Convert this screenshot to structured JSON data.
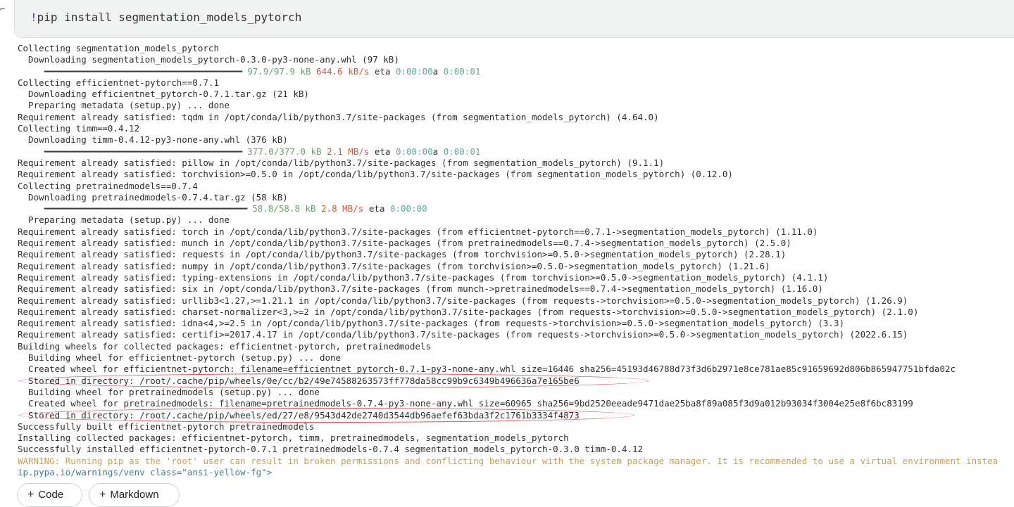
{
  "code": {
    "bang": "!",
    "command": "pip install segmentation_models_pytorch"
  },
  "output_lines": [
    {
      "text": "Collecting segmentation_models_pytorch"
    },
    {
      "text": "  Downloading segmentation_models_pytorch-0.3.0-py3-none-any.whl (97 kB)"
    },
    {
      "progress": {
        "indent": "     ",
        "bar": "━━━━━━━━━━━━━━━━━━━━━━━━━━━━━━━━━━━━━━━━",
        "size": "97.9/97.9 kB",
        "speed": "644.6 kB/s",
        "eta_label": "eta",
        "eta": "0:00:00",
        "extra": "a",
        "eta2": "0:00:01"
      }
    },
    {
      "text": "Collecting efficientnet-pytorch==0.7.1"
    },
    {
      "text": "  Downloading efficientnet_pytorch-0.7.1.tar.gz (21 kB)"
    },
    {
      "text": "  Preparing metadata (setup.py) ... done"
    },
    {
      "text": "Requirement already satisfied: tqdm in /opt/conda/lib/python3.7/site-packages (from segmentation_models_pytorch) (4.64.0)"
    },
    {
      "text": "Collecting timm==0.4.12"
    },
    {
      "text": "  Downloading timm-0.4.12-py3-none-any.whl (376 kB)"
    },
    {
      "progress": {
        "indent": "     ",
        "bar": "━━━━━━━━━━━━━━━━━━━━━━━━━━━━━━━━━━━━━━━━",
        "size": "377.0/377.0 kB",
        "speed": "2.1 MB/s",
        "eta_label": "eta",
        "eta": "0:00:00",
        "extra": "a",
        "eta2": "0:00:01"
      }
    },
    {
      "text": "Requirement already satisfied: pillow in /opt/conda/lib/python3.7/site-packages (from segmentation_models_pytorch) (9.1.1)"
    },
    {
      "text": "Requirement already satisfied: torchvision>=0.5.0 in /opt/conda/lib/python3.7/site-packages (from segmentation_models_pytorch) (0.12.0)"
    },
    {
      "text": "Collecting pretrainedmodels==0.7.4"
    },
    {
      "text": "  Downloading pretrainedmodels-0.7.4.tar.gz (58 kB)"
    },
    {
      "progress": {
        "indent": "     ",
        "bar": "━━━━━━━━━━━━━━━━━━━━━━━━━━━━━━━━━━━━━━━━━",
        "size": "58.8/58.8 kB",
        "speed": "2.8 MB/s",
        "eta_label": "eta",
        "eta": "0:00:00",
        "extra": "",
        "eta2": ""
      }
    },
    {
      "text": "  Preparing metadata (setup.py) ... done"
    },
    {
      "text": "Requirement already satisfied: torch in /opt/conda/lib/python3.7/site-packages (from efficientnet-pytorch==0.7.1->segmentation_models_pytorch) (1.11.0)"
    },
    {
      "text": "Requirement already satisfied: munch in /opt/conda/lib/python3.7/site-packages (from pretrainedmodels==0.7.4->segmentation_models_pytorch) (2.5.0)"
    },
    {
      "text": "Requirement already satisfied: requests in /opt/conda/lib/python3.7/site-packages (from torchvision>=0.5.0->segmentation_models_pytorch) (2.28.1)"
    },
    {
      "text": "Requirement already satisfied: numpy in /opt/conda/lib/python3.7/site-packages (from torchvision>=0.5.0->segmentation_models_pytorch) (1.21.6)"
    },
    {
      "text": "Requirement already satisfied: typing-extensions in /opt/conda/lib/python3.7/site-packages (from torchvision>=0.5.0->segmentation_models_pytorch) (4.1.1)"
    },
    {
      "text": "Requirement already satisfied: six in /opt/conda/lib/python3.7/site-packages (from munch->pretrainedmodels==0.7.4->segmentation_models_pytorch) (1.16.0)"
    },
    {
      "text": "Requirement already satisfied: urllib3<1.27,>=1.21.1 in /opt/conda/lib/python3.7/site-packages (from requests->torchvision>=0.5.0->segmentation_models_pytorch) (1.26.9)"
    },
    {
      "text": "Requirement already satisfied: charset-normalizer<3,>=2 in /opt/conda/lib/python3.7/site-packages (from requests->torchvision>=0.5.0->segmentation_models_pytorch) (2.1.0)"
    },
    {
      "text": "Requirement already satisfied: idna<4,>=2.5 in /opt/conda/lib/python3.7/site-packages (from requests->torchvision>=0.5.0->segmentation_models_pytorch) (3.3)"
    },
    {
      "text": "Requirement already satisfied: certifi>=2017.4.17 in /opt/conda/lib/python3.7/site-packages (from requests->torchvision>=0.5.0->segmentation_models_pytorch) (2022.6.15)"
    },
    {
      "text": "Building wheels for collected packages: efficientnet-pytorch, pretrainedmodels"
    },
    {
      "text": "  Building wheel for efficientnet-pytorch (setup.py) ... done"
    },
    {
      "text": "  Created wheel for efficientnet-pytorch: filename=efficientnet_pytorch-0.7.1-py3-none-any.whl size=16446 sha256=45193d46788d73f3d6b2971e8ce781ae85c91659692d806b865947751bfda02c"
    },
    {
      "text": "  Stored in directory: /root/.cache/pip/wheels/0e/cc/b2/49e74588263573ff778da58cc99b9c6349b496636a7e165be6"
    },
    {
      "text": "  Building wheel for pretrainedmodels (setup.py) ... done"
    },
    {
      "text": "  Created wheel for pretrainedmodels: filename=pretrainedmodels-0.7.4-py3-none-any.whl size=60965 sha256=9bd2520eeade9471dae25ba8f89a085f3d9a012b93034f3004e25e8f6bc83199"
    },
    {
      "text": "  Stored in directory: /root/.cache/pip/wheels/ed/27/e8/9543d42de2740d3544db96aefef63bda3f2c1761b3334f4873"
    },
    {
      "text": "Successfully built efficientnet-pytorch pretrainedmodels"
    },
    {
      "text": "Installing collected packages: efficientnet-pytorch, timm, pretrainedmodels, segmentation_models_pytorch"
    },
    {
      "text": "Successfully installed efficientnet-pytorch-0.7.1 pretrainedmodels-0.7.4 segmentation_models_pytorch-0.3.0 timm-0.4.12"
    },
    {
      "warning": "WARNING: Running pip as the 'root' user can result in broken permissions and conflicting behaviour with the system package manager. It is recommended to use a virtual environment instea"
    },
    {
      "link": "ip.pypa.io/warnings/venv class=\"ansi-yellow-fg\">"
    }
  ],
  "buttons": {
    "code_label": "Code",
    "markdown_label": "Markdown",
    "plus": "+"
  },
  "colors": {
    "annotation": "#d9534f",
    "warning": "#c9a04a",
    "size": "#6aa36a",
    "speed": "#d0573f",
    "eta": "#5fa9a4"
  }
}
